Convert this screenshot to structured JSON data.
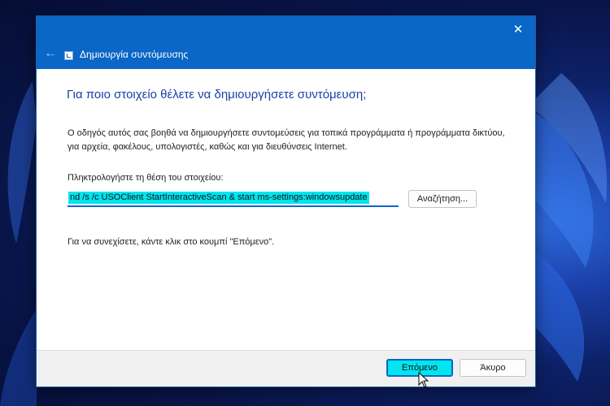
{
  "window": {
    "title": "Δημιουργία συντόμευσης",
    "close_glyph": "✕",
    "back_glyph": "←"
  },
  "content": {
    "heading": "Για ποιο στοιχείο θέλετε να δημιουργήσετε συντόμευση;",
    "description": "Ο οδηγός αυτός σας βοηθά να δημιουργήσετε συντομεύσεις για τοπικά προγράμματα ή προγράμματα δικτύου, για αρχεία, φακέλους, υπολογιστές, καθώς και για διευθύνσεις Internet.",
    "location_label": "Πληκτρολογήστε τη θέση του στοιχείου:",
    "location_value": "nd /s /c USOClient StartInteractiveScan & start ms-settings:windowsupdate",
    "browse_label": "Αναζήτηση...",
    "instruction": "Για να συνεχίσετε, κάντε κλικ στο κουμπί \"Επόμενο\"."
  },
  "footer": {
    "next_label": "Επόμενο",
    "cancel_label": "Άκυρο"
  },
  "colors": {
    "titlebar": "#0a66c7",
    "heading": "#1a3fa6",
    "highlight": "#00e5ee"
  },
  "icons": {
    "app": "shortcut-icon",
    "back": "back-arrow-icon",
    "close": "close-icon",
    "cursor": "mouse-pointer-icon"
  }
}
